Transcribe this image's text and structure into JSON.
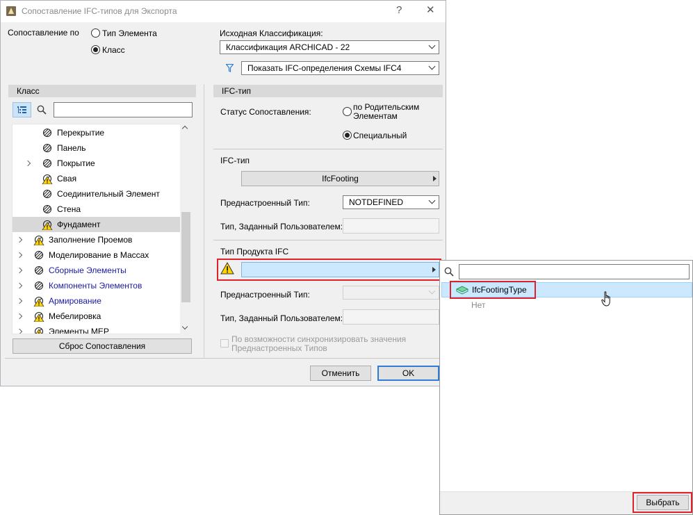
{
  "window": {
    "title": "Сопоставление IFC-типов для Экспорта",
    "help": "?",
    "close": "✕"
  },
  "mapping_by": {
    "label": "Сопоставление по",
    "option_element_type": "Тип Элемента",
    "option_class": "Класс"
  },
  "source_classification": {
    "label": "Исходная Классификация:",
    "value": "Классификация ARCHICAD - 22"
  },
  "filter_combo": {
    "value": "Показать IFC-определения Схемы IFC4"
  },
  "left_panel": {
    "header": "Класс",
    "search_placeholder": "",
    "tree": [
      {
        "label": "Перекрытие",
        "indent": 2,
        "expander": false,
        "icon": "slab-icon",
        "color": "black"
      },
      {
        "label": "Панель",
        "indent": 2,
        "expander": false,
        "icon": "panel-icon",
        "color": "black"
      },
      {
        "label": "Покрытие",
        "indent": 2,
        "expander": true,
        "icon": "covering-icon",
        "color": "black"
      },
      {
        "label": "Свая",
        "indent": 2,
        "expander": false,
        "icon": "warning-pile-icon",
        "color": "black"
      },
      {
        "label": "Соединительный Элемент",
        "indent": 2,
        "expander": false,
        "icon": "connector-icon",
        "color": "black"
      },
      {
        "label": "Стена",
        "indent": 2,
        "expander": false,
        "icon": "wall-icon",
        "color": "black"
      },
      {
        "label": "Фундамент",
        "indent": 2,
        "expander": false,
        "icon": "warning-footing-icon",
        "color": "black",
        "selected": true
      },
      {
        "label": "Заполнение Проемов",
        "indent": 1,
        "expander": true,
        "icon": "warning-opening-icon",
        "color": "black"
      },
      {
        "label": "Моделирование в Массах",
        "indent": 1,
        "expander": true,
        "icon": "mass-icon",
        "color": "black"
      },
      {
        "label": "Сборные Элементы",
        "indent": 1,
        "expander": true,
        "icon": "assembly-icon",
        "color": "blue"
      },
      {
        "label": "Компоненты Элементов",
        "indent": 1,
        "expander": true,
        "icon": "component-icon",
        "color": "blue"
      },
      {
        "label": "Армирование",
        "indent": 1,
        "expander": true,
        "icon": "warning-rebar-icon",
        "color": "blue"
      },
      {
        "label": "Мебелировка",
        "indent": 1,
        "expander": true,
        "icon": "warning-furniture-icon",
        "color": "black"
      },
      {
        "label": "Элементы MEP",
        "indent": 1,
        "expander": true,
        "icon": "warning-mep-icon",
        "color": "black"
      }
    ],
    "reset_button": "Сброс Сопоставления"
  },
  "right_panel": {
    "header": "IFC-тип",
    "status_label": "Статус Сопоставления:",
    "status_opt_parent": "по Родительским Элементам",
    "status_opt_special": "Специальный",
    "ifc_type_section": "IFC-тип",
    "ifc_type_value": "IfcFooting",
    "predefined_label": "Преднастроенный Тип:",
    "predefined_value": "NOTDEFINED",
    "user_defined_label": "Тип, Заданный Пользователем:",
    "product_section": "Тип Продукта IFC",
    "product_value": "",
    "predefined2_label": "Преднастроенный Тип:",
    "user_defined2_label": "Тип, Заданный Пользователем:",
    "sync_checkbox": "По возможности синхронизировать значения Преднастроенных Типов"
  },
  "buttons": {
    "cancel": "Отменить",
    "ok": "OK"
  },
  "popup": {
    "search_placeholder": "",
    "items": [
      {
        "label": "IfcFootingType",
        "selected": true
      },
      {
        "label": "Нет",
        "selected": false
      }
    ],
    "select_button": "Выбрать"
  },
  "colors": {
    "highlight_red": "#e0202a",
    "selection_blue": "#cce8ff",
    "link_blue": "#1a1aa6",
    "ok_border": "#2f7cd6"
  }
}
